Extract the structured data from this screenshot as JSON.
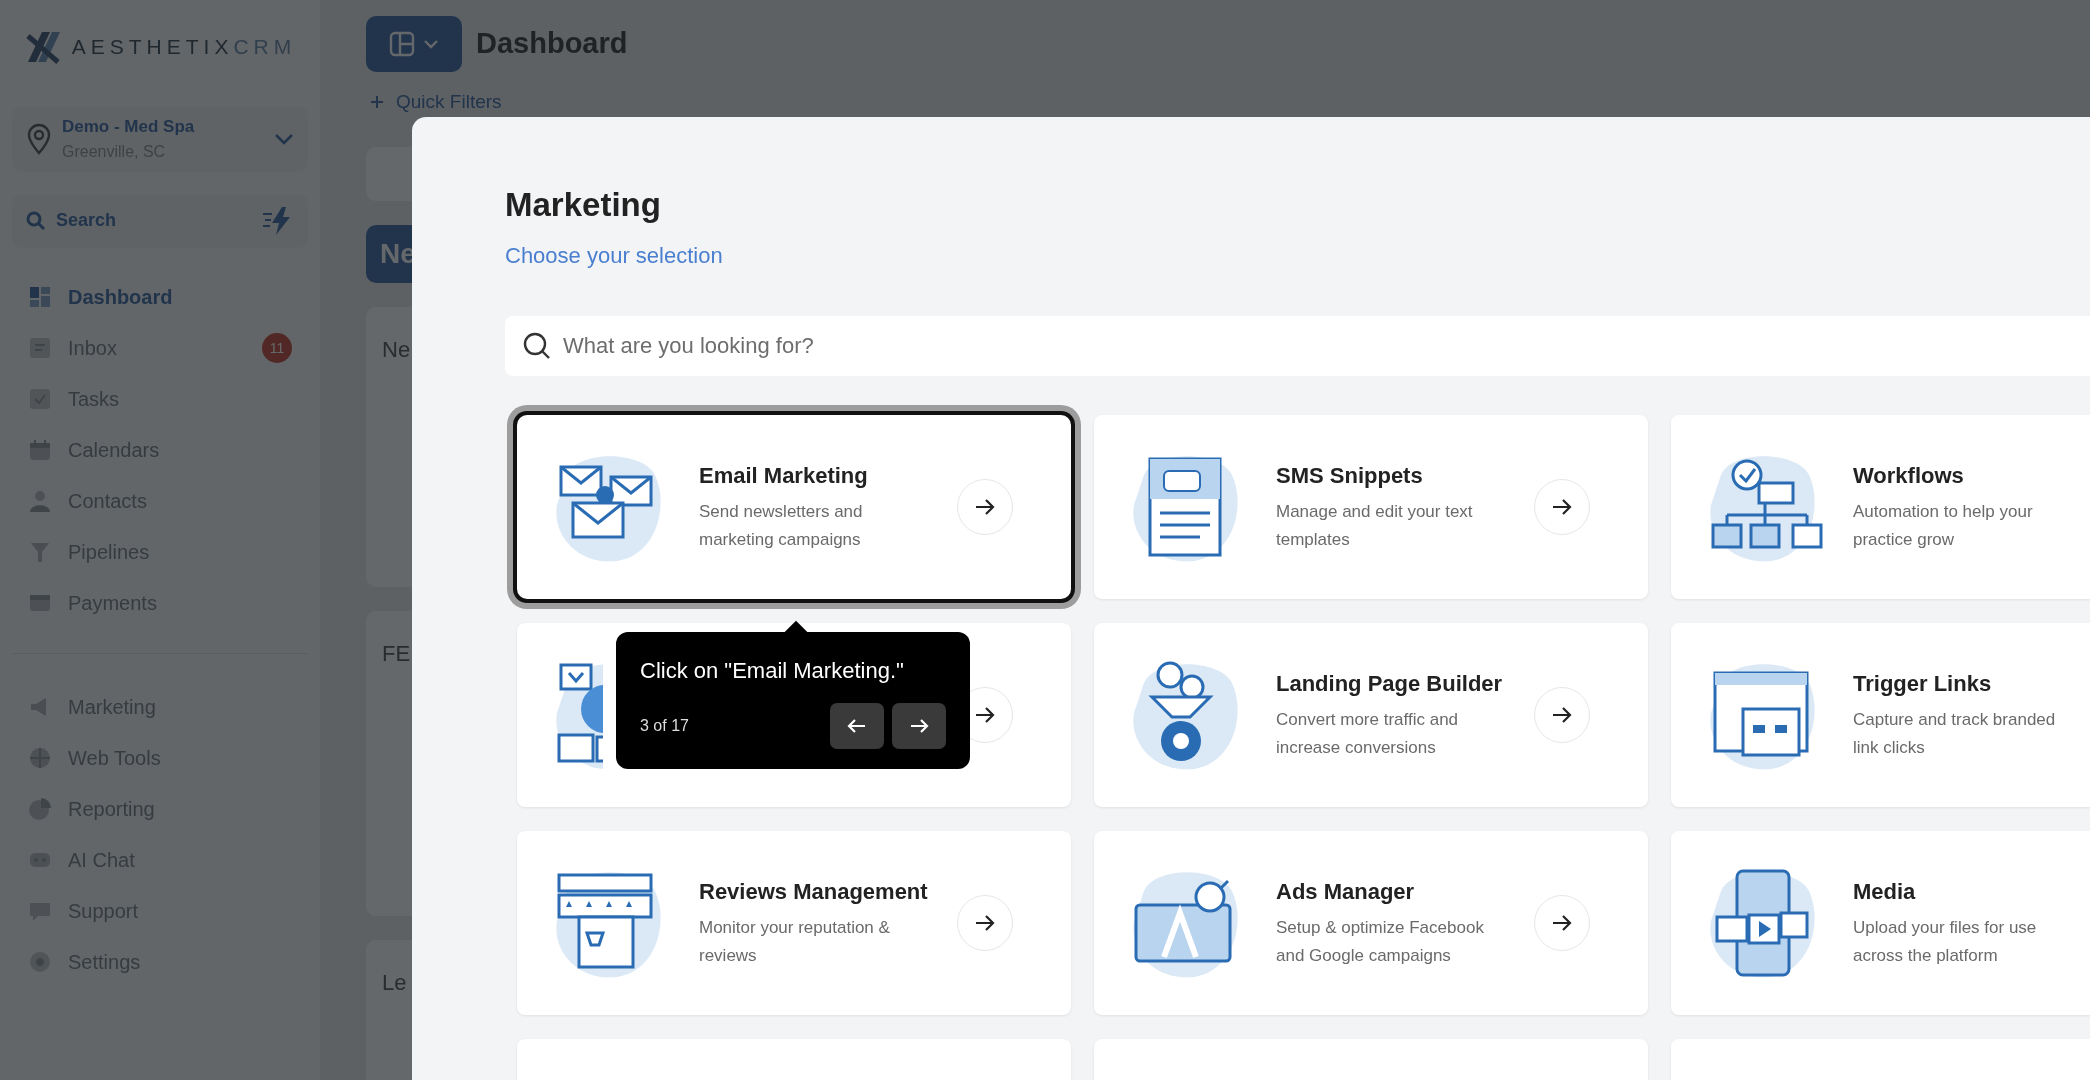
{
  "sidebar": {
    "logo": {
      "brand": "AESTHETIX",
      "suffix": "CRM"
    },
    "location": {
      "name": "Demo - Med Spa",
      "city": "Greenville, SC"
    },
    "search": {
      "placeholder": "Search"
    },
    "nav_groups": [
      [
        {
          "label": "Dashboard",
          "selected": true
        },
        {
          "label": "Inbox",
          "selected": false,
          "badge": "11"
        },
        {
          "label": "Tasks",
          "selected": false
        },
        {
          "label": "Calendars",
          "selected": false
        },
        {
          "label": "Contacts",
          "selected": false
        },
        {
          "label": "Pipelines",
          "selected": false
        },
        {
          "label": "Payments",
          "selected": false
        }
      ],
      [
        {
          "label": "Marketing",
          "selected": false
        },
        {
          "label": "Web Tools",
          "selected": false
        },
        {
          "label": "Reporting",
          "selected": false
        },
        {
          "label": "AI Chat",
          "selected": false
        },
        {
          "label": "Support",
          "selected": false
        },
        {
          "label": "Settings",
          "selected": false
        }
      ]
    ]
  },
  "header": {
    "title": "Dashboard",
    "quick_filters": "Quick Filters",
    "button_text": "Ne",
    "card_titles": [
      "Ne",
      "FE",
      "Le"
    ]
  },
  "modal": {
    "title": "Marketing",
    "subtitle": "Choose your selection",
    "search": {
      "placeholder": "What are you looking for?"
    },
    "cards": [
      {
        "kind": "full",
        "title": "Email Marketing",
        "description": "Send newsletters and marketing campaigns",
        "highlighted": true,
        "arrow": true
      },
      {
        "kind": "full",
        "title": "SMS Snippets",
        "description": "Manage and edit your text templates",
        "highlighted": false,
        "arrow": true
      },
      {
        "kind": "full",
        "title": "Workflows",
        "description": "Automation to help your practice grow",
        "highlighted": false,
        "arrow": false
      },
      {
        "kind": "covered",
        "highlighted": false,
        "arrow": true
      },
      {
        "kind": "full",
        "title": "Landing Page Builder",
        "description": "Convert more traffic and increase conversions",
        "highlighted": false,
        "arrow": true
      },
      {
        "kind": "full",
        "title": "Trigger Links",
        "description": "Capture and track branded link clicks",
        "highlighted": false,
        "arrow": false
      },
      {
        "kind": "full",
        "title": "Reviews Management",
        "description": "Monitor your reputation & reviews",
        "highlighted": false,
        "arrow": true
      },
      {
        "kind": "full",
        "title": "Ads Manager",
        "description": "Setup & optimize Facebook and Google campaigns",
        "highlighted": false,
        "arrow": true
      },
      {
        "kind": "full",
        "title": "Media",
        "description": "Upload your files for use across the platform",
        "highlighted": false,
        "arrow": false
      },
      {
        "kind": "cut"
      },
      {
        "kind": "cut"
      },
      {
        "kind": "cut"
      }
    ],
    "tour": {
      "text": "Click on \"Email Marketing.\"",
      "step": "3 of 17"
    }
  }
}
